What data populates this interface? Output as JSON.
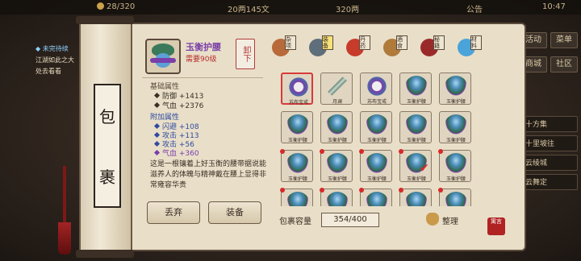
{
  "topbar": {
    "stamina": "28/320",
    "money": "20两145文",
    "silver": "320两",
    "notice": "公告",
    "time": "10:47"
  },
  "left_log": {
    "quest": "◆ 未完待续",
    "lines": [
      "江湖如此之大",
      "处去看看"
    ]
  },
  "right_menu": [
    "活动",
    "菜单",
    "商城",
    "社区"
  ],
  "right_list": [
    "十方集",
    "十里坡往",
    "云绫城",
    "云舞定"
  ],
  "scroll_title": [
    "包",
    "裹"
  ],
  "detail": {
    "name": "玉衡护腰",
    "req": "需要90级",
    "unequip": "卸下",
    "base_title": "基础属性",
    "base": [
      {
        "k": "防御",
        "v": "+1413"
      },
      {
        "k": "气血",
        "v": "+2376"
      }
    ],
    "extra_title": "附加属性",
    "extra": [
      {
        "k": "闪避",
        "v": "+108",
        "c": "blue"
      },
      {
        "k": "攻击",
        "v": "+113",
        "c": "blue"
      },
      {
        "k": "攻击",
        "v": "+56",
        "c": "blue"
      },
      {
        "k": "气血",
        "v": "+360",
        "c": "purple"
      }
    ],
    "desc": "这是一根镶着上好玉衡的腰带据说能滋养人的体魄与精神戴在腰上显得非常雍容华贵"
  },
  "buttons": {
    "discard": "丢弃",
    "equip": "装备"
  },
  "categories": [
    {
      "label": "杂项",
      "icon": "bag-icon",
      "color": "#b86a3a"
    },
    {
      "label": "装备",
      "icon": "sword-icon",
      "color": "#5e6e7a",
      "active": true
    },
    {
      "label": "丹药",
      "icon": "pill-icon",
      "color": "#c73b2a"
    },
    {
      "label": "酒食",
      "icon": "wine-icon",
      "color": "#b07a3a"
    },
    {
      "label": "秘籍",
      "icon": "book-icon",
      "color": "#9a2a2a"
    },
    {
      "label": "材料",
      "icon": "crystal-icon",
      "color": "#4aa3d9"
    }
  ],
  "items": [
    {
      "name": "苏布宝戒",
      "kind": "ring",
      "sel": true
    },
    {
      "name": "月澜",
      "kind": "blade"
    },
    {
      "name": "苏布宝戒",
      "kind": "ring"
    },
    {
      "name": "玉衡护腰",
      "kind": "hat"
    },
    {
      "name": "玉衡护腰",
      "kind": "hat"
    },
    {
      "name": "玉衡护腰",
      "kind": "hat"
    },
    {
      "name": "玉衡护腰",
      "kind": "hat"
    },
    {
      "name": "玉衡护腰",
      "kind": "hat"
    },
    {
      "name": "玉衡护腰",
      "kind": "hat"
    },
    {
      "name": "玉衡护腰",
      "kind": "hat"
    },
    {
      "name": "玉衡护腰",
      "kind": "hat"
    },
    {
      "name": "玉衡护腰",
      "kind": "hat"
    },
    {
      "name": "玉衡护腰",
      "kind": "hat"
    },
    {
      "name": "玉衡护腰",
      "kind": "hat",
      "check": true
    },
    {
      "name": "玉衡护腰",
      "kind": "hat"
    },
    {
      "name": "",
      "kind": "hat"
    },
    {
      "name": "",
      "kind": "hat"
    },
    {
      "name": "",
      "kind": "hat"
    },
    {
      "name": "",
      "kind": "hat"
    },
    {
      "name": "",
      "kind": "hat"
    }
  ],
  "capacity": {
    "label": "包裹容量",
    "value": "354/400"
  },
  "sort": "整理",
  "seal": "寓言"
}
